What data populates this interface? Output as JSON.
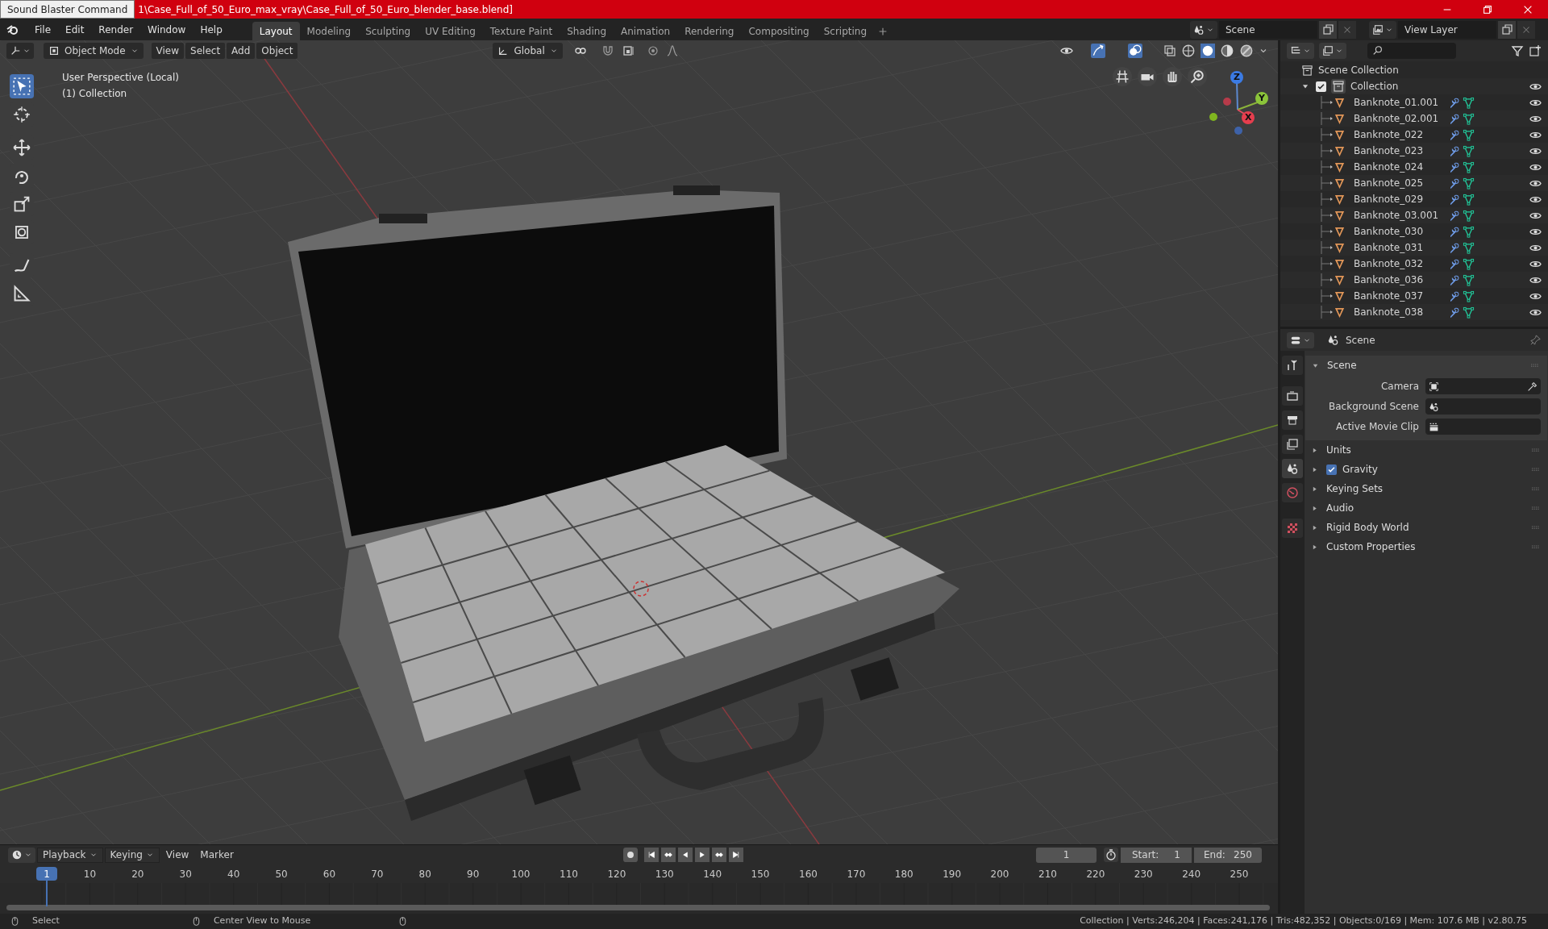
{
  "title_bar": {
    "tooltip": "Sound Blaster Command",
    "title": "1\\Case_Full_of_50_Euro_max_vray\\Case_Full_of_50_Euro_blender_base.blend]"
  },
  "menu": [
    "File",
    "Edit",
    "Render",
    "Window",
    "Help"
  ],
  "workspaces": [
    {
      "label": "Layout",
      "selected": true
    },
    {
      "label": "Modeling",
      "selected": false
    },
    {
      "label": "Sculpting",
      "selected": false
    },
    {
      "label": "UV Editing",
      "selected": false
    },
    {
      "label": "Texture Paint",
      "selected": false
    },
    {
      "label": "Shading",
      "selected": false
    },
    {
      "label": "Animation",
      "selected": false
    },
    {
      "label": "Rendering",
      "selected": false
    },
    {
      "label": "Compositing",
      "selected": false
    },
    {
      "label": "Scripting",
      "selected": false
    }
  ],
  "scene_field": "Scene",
  "view_layer_field": "View Layer",
  "viewport_header": {
    "mode": "Object Mode",
    "menus": [
      "View",
      "Select",
      "Add",
      "Object"
    ],
    "orientation": "Global"
  },
  "viewport": {
    "perspective": "User Perspective (Local)",
    "collection": "(1) Collection",
    "gizmo_axes": [
      {
        "kind": "z",
        "label": "Z"
      },
      {
        "kind": "y",
        "label": "Y"
      },
      {
        "kind": "x",
        "label": "X"
      }
    ]
  },
  "outliner": {
    "root": "Scene Collection",
    "collection": {
      "name": "Collection",
      "checked": true,
      "expanded": true,
      "children": [
        {
          "name": "Banknote_01.001"
        },
        {
          "name": "Banknote_02.001"
        },
        {
          "name": "Banknote_022"
        },
        {
          "name": "Banknote_023"
        },
        {
          "name": "Banknote_024"
        },
        {
          "name": "Banknote_025"
        },
        {
          "name": "Banknote_029"
        },
        {
          "name": "Banknote_03.001"
        },
        {
          "name": "Banknote_030"
        },
        {
          "name": "Banknote_031"
        },
        {
          "name": "Banknote_032"
        },
        {
          "name": "Banknote_036"
        },
        {
          "name": "Banknote_037"
        },
        {
          "name": "Banknote_038"
        }
      ]
    }
  },
  "properties": {
    "context": "Scene",
    "panels": [
      {
        "title": "Scene",
        "expanded": true,
        "fields": [
          {
            "kind": "camera",
            "label": "Camera"
          },
          {
            "kind": "scene",
            "label": "Background Scene"
          },
          {
            "kind": "clip",
            "label": "Active Movie Clip"
          }
        ]
      },
      {
        "title": "Units",
        "expanded": false
      },
      {
        "title": "Gravity",
        "expanded": false,
        "checked": true
      },
      {
        "title": "Keying Sets",
        "expanded": false
      },
      {
        "title": "Audio",
        "expanded": false
      },
      {
        "title": "Rigid Body World",
        "expanded": false
      },
      {
        "title": "Custom Properties",
        "expanded": false
      }
    ]
  },
  "timeline": {
    "menus": [
      "Playback",
      "Keying",
      "View",
      "Marker"
    ],
    "current_frame": "1",
    "start_label": "Start:",
    "start": "1",
    "end_label": "End:",
    "end": "250",
    "ruler": [
      {
        "label": "1",
        "selected": true
      },
      {
        "label": "10",
        "selected": false
      },
      {
        "label": "20",
        "selected": false
      },
      {
        "label": "30",
        "selected": false
      },
      {
        "label": "40",
        "selected": false
      },
      {
        "label": "50",
        "selected": false
      },
      {
        "label": "60",
        "selected": false
      },
      {
        "label": "70",
        "selected": false
      },
      {
        "label": "80",
        "selected": false
      },
      {
        "label": "90",
        "selected": false
      },
      {
        "label": "100",
        "selected": false
      },
      {
        "label": "110",
        "selected": false
      },
      {
        "label": "120",
        "selected": false
      },
      {
        "label": "130",
        "selected": false
      },
      {
        "label": "140",
        "selected": false
      },
      {
        "label": "150",
        "selected": false
      },
      {
        "label": "160",
        "selected": false
      },
      {
        "label": "170",
        "selected": false
      },
      {
        "label": "180",
        "selected": false
      },
      {
        "label": "190",
        "selected": false
      },
      {
        "label": "200",
        "selected": false
      },
      {
        "label": "210",
        "selected": false
      },
      {
        "label": "220",
        "selected": false
      },
      {
        "label": "230",
        "selected": false
      },
      {
        "label": "240",
        "selected": false
      },
      {
        "label": "250",
        "selected": false
      }
    ]
  },
  "status_bar": {
    "hints": [
      "Select",
      "Center View to Mouse"
    ],
    "stats": "Collection | Verts:246,204 | Faces:241,176 | Tris:482,352 | Objects:0/169 | Mem: 107.6 MB | v2.80.75"
  }
}
